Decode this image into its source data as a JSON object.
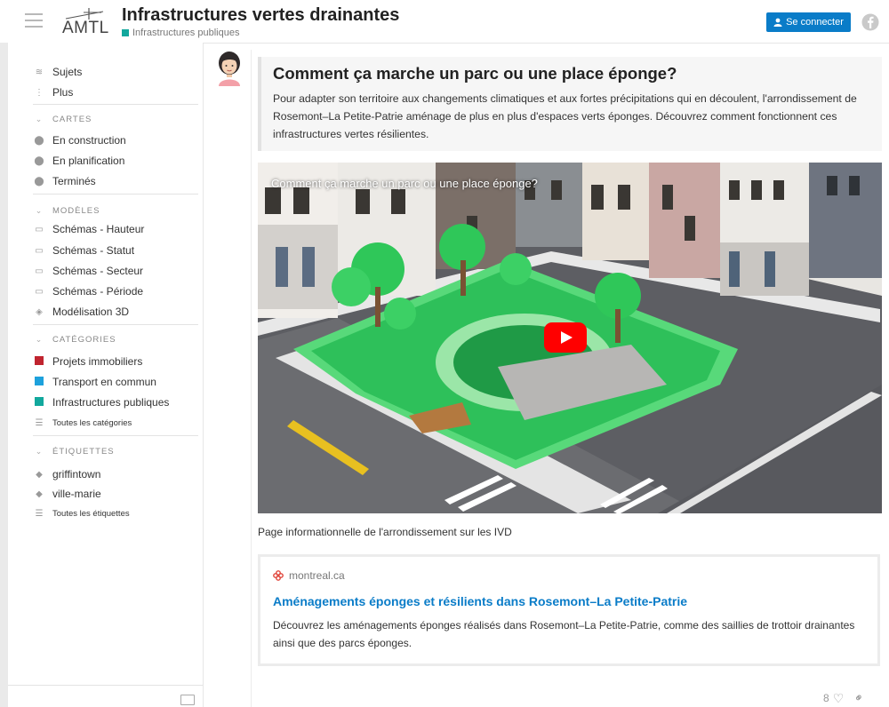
{
  "header": {
    "logo_text": "AMTL",
    "title": "Infrastructures vertes drainantes",
    "category": "Infrastructures publiques",
    "category_color": "#12a89d",
    "login_label": "Se connecter",
    "login_color": "#0a7cc8"
  },
  "sidebar": {
    "top_items": [
      {
        "label": "Sujets",
        "icon": "layers-icon"
      },
      {
        "label": "Plus",
        "icon": "vertical-dots-icon"
      }
    ],
    "sections": [
      {
        "heading": "CARTES",
        "items": [
          {
            "label": "En construction",
            "icon": "map-pin-icon"
          },
          {
            "label": "En planification",
            "icon": "map-pin-icon"
          },
          {
            "label": "Terminés",
            "icon": "map-pin-icon"
          }
        ]
      },
      {
        "heading": "MODÈLES",
        "items": [
          {
            "label": "Schémas - Hauteur",
            "icon": "image-icon"
          },
          {
            "label": "Schémas - Statut",
            "icon": "image-icon"
          },
          {
            "label": "Schémas - Secteur",
            "icon": "image-icon"
          },
          {
            "label": "Schémas - Période",
            "icon": "image-icon"
          },
          {
            "label": "Modélisation 3D",
            "icon": "cube-icon"
          }
        ]
      },
      {
        "heading": "CATÉGORIES",
        "items": [
          {
            "label": "Projets immobiliers",
            "color": "#c0242f"
          },
          {
            "label": "Transport en commun",
            "color": "#1da1dc"
          },
          {
            "label": "Infrastructures publiques",
            "color": "#12a89d"
          },
          {
            "label": "Toutes les catégories",
            "icon": "list-icon"
          }
        ]
      },
      {
        "heading": "ÉTIQUETTES",
        "items": [
          {
            "label": "griffintown",
            "icon": "tag-icon"
          },
          {
            "label": "ville-marie",
            "icon": "tag-icon"
          },
          {
            "label": "Toutes les étiquettes",
            "icon": "list-icon"
          }
        ]
      }
    ]
  },
  "post": {
    "heading": "Comment ça marche un parc ou une place éponge?",
    "body": "Pour adapter son territoire aux changements climatiques et aux fortes précipitations qui en découlent, l'arrondissement de Rosemont–La Petite-Patrie aménage de plus en plus d'espaces verts éponges. Découvrez comment fonctionnent ces infrastructures vertes résilientes.",
    "video_title": "Comment ça marche un parc ou une place éponge?",
    "caption": "Page informationnelle de l'arrondissement sur les IVD",
    "onebox": {
      "source": "montreal.ca",
      "title": "Aménagements éponges et résilients dans Rosemont–La Petite-Patrie",
      "description": "Découvrez les aménagements éponges réalisés dans Rosemont–La Petite-Patrie, comme des saillies de trottoir drainantes ainsi que des parcs éponges.",
      "title_color": "#0a7cc8"
    },
    "like_count": "8"
  }
}
